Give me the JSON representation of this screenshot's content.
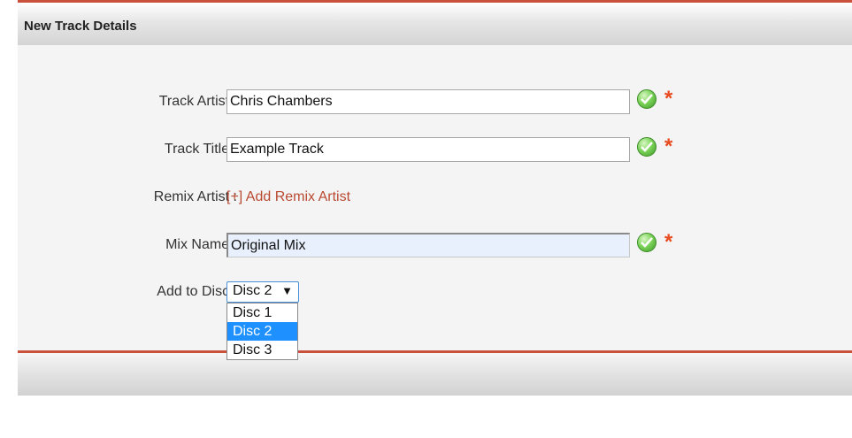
{
  "panel": {
    "title": "New Track Details"
  },
  "form": {
    "track_artist": {
      "label": "Track Artist :",
      "value": "Chris Chambers",
      "required_mark": "*"
    },
    "track_title": {
      "label": "Track Title :",
      "value": "Example Track",
      "required_mark": "*"
    },
    "remix_artist": {
      "label": "Remix Artist :",
      "link_text": "[+] Add Remix Artist"
    },
    "mix_name": {
      "label": "Mix Name :",
      "value": "Original Mix",
      "required_mark": "*"
    },
    "disc": {
      "label": "Add to Disc :",
      "selected": "Disc 2",
      "arrow": "▼",
      "options": [
        "Disc 1",
        "Disc 2",
        "Disc 3"
      ]
    }
  },
  "colors": {
    "accent": "#c9503a",
    "required": "#e8491d",
    "link": "#b94a32",
    "selection": "#1e90ff",
    "valid": "#5cb83a"
  },
  "icons": {
    "valid": "checkmark-circle-icon"
  }
}
